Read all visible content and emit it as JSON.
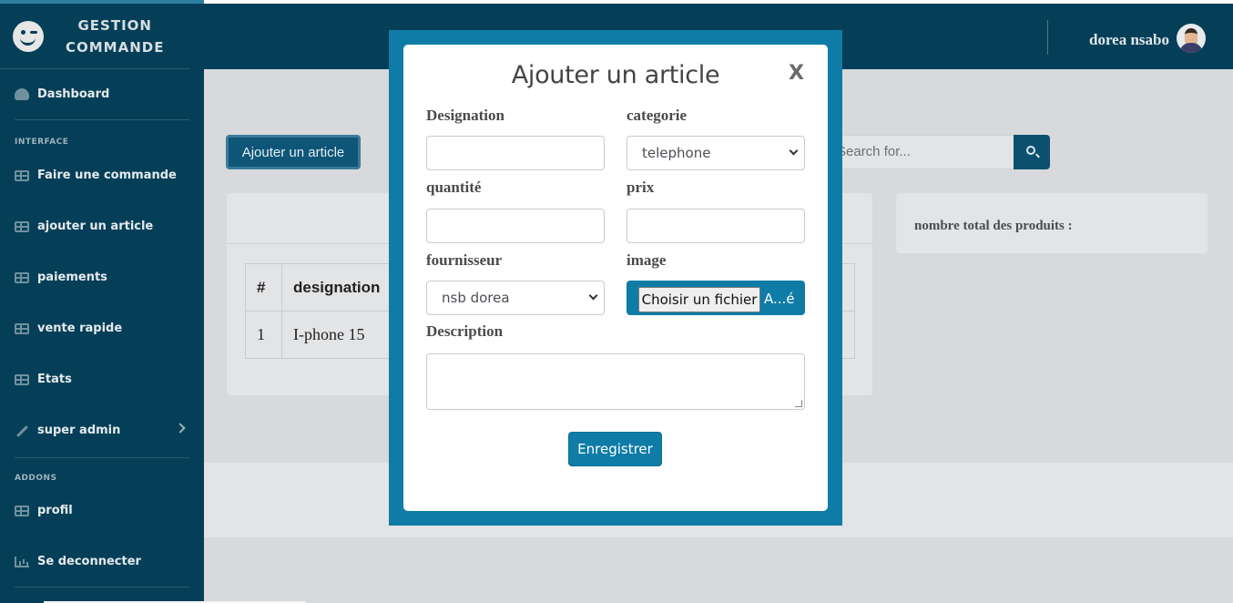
{
  "brand": {
    "line1": "GESTION",
    "line2": "COMMANDE"
  },
  "sidebar": {
    "dashboard": "Dashboard",
    "heading_interface": "INTERFACE",
    "items": [
      {
        "label": "Faire une commande"
      },
      {
        "label": "ajouter un article"
      },
      {
        "label": "paiements"
      },
      {
        "label": "vente rapide"
      },
      {
        "label": "Etats"
      },
      {
        "label": "super admin"
      }
    ],
    "heading_addons": "ADDONS",
    "addons": [
      {
        "label": "profil"
      },
      {
        "label": "Se deconnecter"
      }
    ]
  },
  "topbar": {
    "user_name": "dorea nsabo"
  },
  "page": {
    "add_button": "Ajouter un article",
    "search_placeholder": "Search for...",
    "table": {
      "headers": [
        "#",
        "designation"
      ],
      "rows": [
        {
          "num": "1",
          "designation": "I-phone 15"
        }
      ]
    },
    "stat_label": "nombre total des produits :"
  },
  "modal": {
    "title": "Ajouter un article",
    "close": "X",
    "labels": {
      "designation": "Designation",
      "categorie": "categorie",
      "quantite": "quantité",
      "prix": "prix",
      "fournisseur": "fournisseur",
      "image": "image",
      "description": "Description"
    },
    "values": {
      "designation": "",
      "categorie": "telephone",
      "quantite": "",
      "prix": "",
      "fournisseur": "nsb dorea",
      "description": ""
    },
    "file_button": "Choisir un fichier",
    "file_name": "A...é",
    "save_button": "Enregistrer"
  },
  "colors": {
    "sidebar_bg": "#053f57",
    "modal_frame": "#0f7ca7",
    "primary_button": "#0f7ca7"
  }
}
